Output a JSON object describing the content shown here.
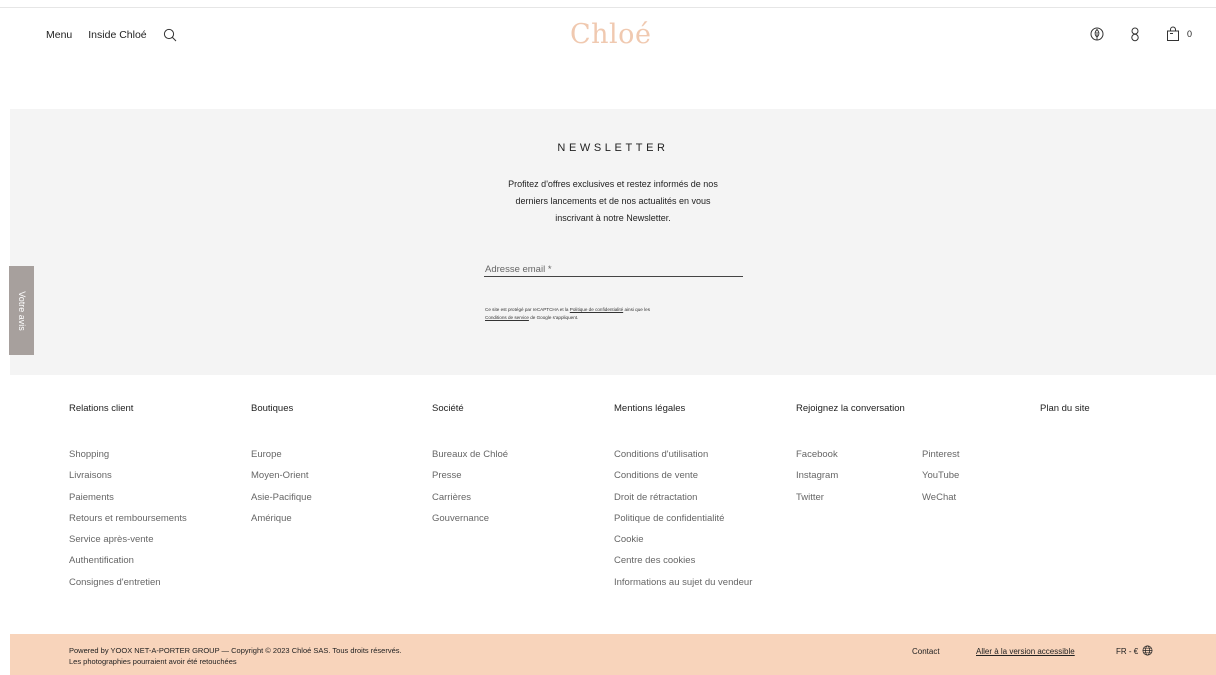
{
  "header": {
    "menu_label": "Menu",
    "inside_label": "Inside Chloé",
    "logo_text": "Chloé",
    "cart_count": "0",
    "logo_color": "#f0c9b0"
  },
  "newsletter": {
    "title": "NEWSLETTER",
    "line1": "Profitez d'offres exclusives et restez informés de nos",
    "line2": "derniers lancements et de nos actualités en vous",
    "line3": "inscrivant à notre Newsletter.",
    "email_placeholder": "Adresse email *",
    "legal_pre": "Ce site est protégé par reCAPTCHA et la ",
    "legal_privacy_link": "Politique de confidentialité",
    "legal_mid": " ainsi que les",
    "legal_terms_link": "Conditions de service",
    "legal_post": " de Google s'appliquent.",
    "background": "#f4f4f4"
  },
  "feedback_tab": {
    "label": "Votre avis"
  },
  "footer": {
    "columns": [
      {
        "title": "Relations client",
        "items": [
          "Shopping",
          "Livraisons",
          "Paiements",
          "Retours et remboursements",
          "Service après-vente",
          "Authentification",
          "Consignes d'entretien"
        ]
      },
      {
        "title": "Boutiques",
        "items": [
          "Europe",
          "Moyen-Orient",
          "Asie-Pacifique",
          "Amérique"
        ]
      },
      {
        "title": "Société",
        "items": [
          "Bureaux de Chloé",
          "Presse",
          "Carrières",
          "Gouvernance"
        ]
      },
      {
        "title": "Mentions légales",
        "items": [
          "Conditions d'utilisation",
          "Conditions de vente",
          "Droit de rétractation",
          "Politique de confidentialité",
          "Cookie",
          "Centre des cookies",
          "Informations au sujet du vendeur"
        ]
      },
      {
        "title": "Rejoignez la conversation",
        "items": [
          "Facebook",
          "Instagram",
          "Twitter"
        ],
        "items2": [
          "Pinterest",
          "YouTube",
          "WeChat"
        ]
      },
      {
        "title": "Plan du site",
        "items": []
      }
    ]
  },
  "footer_bar": {
    "copyright": "Powered by YOOX NET-A-PORTER GROUP — Copyright © 2023 Chloé SAS. Tous droits réservés.",
    "photo_note": "Les photographies pourraient avoir été retouchées",
    "contact": "Contact",
    "accessible": "Aller à la version accessible",
    "locale": "FR - €",
    "background": "#f8d4bb"
  }
}
